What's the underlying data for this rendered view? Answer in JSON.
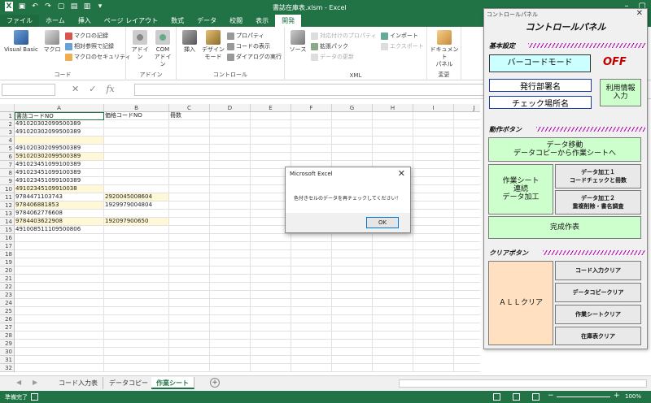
{
  "window": {
    "title": "書誌在庫表.xlsm - Excel"
  },
  "ribbon_tabs": [
    "ファイル",
    "ホーム",
    "挿入",
    "ページ レイアウト",
    "数式",
    "データ",
    "校閲",
    "表示",
    "開発"
  ],
  "ribbon": {
    "code_group": {
      "label": "コード",
      "visual_basic": "Visual Basic",
      "macro": "マクロ",
      "record_macro": "マクロの記録",
      "relative_ref": "相対参照で記録",
      "macro_security": "マクロのセキュリティ"
    },
    "addin_group": {
      "label": "アドイン",
      "addin": "アドイン",
      "com_addin_1": "COM",
      "com_addin_2": "アドイン"
    },
    "controls_group": {
      "label": "コントロール",
      "insert": "挿入",
      "design_mode_1": "デザイン",
      "design_mode_2": "モード",
      "properties": "プロパティ",
      "view_code": "コードの表示",
      "run_dialog": "ダイアログの実行"
    },
    "xml_group": {
      "label": "XML",
      "source": "ソース",
      "map_props": "対応付けのプロパティ",
      "expansion_pack": "拡張パック",
      "refresh": "データの更新",
      "import": "インポート",
      "export": "エクスポート"
    },
    "modify_group": {
      "label": "変更",
      "doc_panel_1": "ドキュメント",
      "doc_panel_2": "パネル"
    }
  },
  "formula_bar": {
    "fx": "fx",
    "cancel": "✕",
    "enter": "✓"
  },
  "columns": [
    "A",
    "B",
    "C",
    "D",
    "E",
    "F",
    "G",
    "H",
    "I",
    "J"
  ],
  "rows": [
    {
      "n": "1",
      "a": "書誌コードNO",
      "b": "価格コードNO",
      "c": "冊数",
      "ya": false,
      "yb": false
    },
    {
      "n": "2",
      "a": "4910203020995003​89",
      "b": "",
      "c": "",
      "ya": false,
      "yb": false
    },
    {
      "n": "3",
      "a": "491020302099500389",
      "b": "",
      "c": "",
      "ya": false,
      "yb": false
    },
    {
      "n": "4",
      "a": "",
      "b": "",
      "c": "",
      "ya": true,
      "yb": false
    },
    {
      "n": "5",
      "a": "491020302099500389",
      "b": "",
      "c": "",
      "ya": false,
      "yb": false
    },
    {
      "n": "6",
      "a": "591020302099500389",
      "b": "",
      "c": "",
      "ya": true,
      "yb": false
    },
    {
      "n": "7",
      "a": "491023451099100389",
      "b": "",
      "c": "",
      "ya": false,
      "yb": false
    },
    {
      "n": "8",
      "a": "491023451099100389",
      "b": "",
      "c": "",
      "ya": false,
      "yb": false
    },
    {
      "n": "9",
      "a": "491023451099100389",
      "b": "",
      "c": "",
      "ya": false,
      "yb": false
    },
    {
      "n": "10",
      "a": "4910234510991003​8",
      "b": "",
      "c": "",
      "ya": true,
      "yb": false
    },
    {
      "n": "11",
      "a": "9784471103743",
      "b": "2920045008604",
      "c": "",
      "ya": false,
      "yb": true
    },
    {
      "n": "12",
      "a": "9784068818​53",
      "b": "1929979004804",
      "c": "",
      "ya": true,
      "yb": false
    },
    {
      "n": "13",
      "a": "9784062776608",
      "b": "",
      "c": "",
      "ya": false,
      "yb": false
    },
    {
      "n": "14",
      "a": "9784403622908",
      "b": "192097900650",
      "c": "",
      "ya": true,
      "yb": true
    },
    {
      "n": "15",
      "a": "491008511109500806",
      "b": "",
      "c": "",
      "ya": false,
      "yb": false
    },
    {
      "n": "16",
      "a": "",
      "b": "",
      "c": "",
      "ya": false,
      "yb": false
    },
    {
      "n": "17",
      "a": "",
      "b": "",
      "c": "",
      "ya": false,
      "yb": false
    },
    {
      "n": "18",
      "a": "",
      "b": "",
      "c": "",
      "ya": false,
      "yb": false
    },
    {
      "n": "19",
      "a": "",
      "b": "",
      "c": "",
      "ya": false,
      "yb": false
    },
    {
      "n": "20",
      "a": "",
      "b": "",
      "c": "",
      "ya": false,
      "yb": false
    },
    {
      "n": "21",
      "a": "",
      "b": "",
      "c": "",
      "ya": false,
      "yb": false
    },
    {
      "n": "22",
      "a": "",
      "b": "",
      "c": "",
      "ya": false,
      "yb": false
    },
    {
      "n": "23",
      "a": "",
      "b": "",
      "c": "",
      "ya": false,
      "yb": false
    },
    {
      "n": "24",
      "a": "",
      "b": "",
      "c": "",
      "ya": false,
      "yb": false
    },
    {
      "n": "25",
      "a": "",
      "b": "",
      "c": "",
      "ya": false,
      "yb": false
    },
    {
      "n": "26",
      "a": "",
      "b": "",
      "c": "",
      "ya": false,
      "yb": false
    },
    {
      "n": "27",
      "a": "",
      "b": "",
      "c": "",
      "ya": false,
      "yb": false
    },
    {
      "n": "28",
      "a": "",
      "b": "",
      "c": "",
      "ya": false,
      "yb": false
    },
    {
      "n": "29",
      "a": "",
      "b": "",
      "c": "",
      "ya": false,
      "yb": false
    },
    {
      "n": "30",
      "a": "",
      "b": "",
      "c": "",
      "ya": false,
      "yb": false
    },
    {
      "n": "31",
      "a": "",
      "b": "",
      "c": "",
      "ya": false,
      "yb": false
    },
    {
      "n": "32",
      "a": "",
      "b": "",
      "c": "",
      "ya": false,
      "yb": false
    }
  ],
  "dialog": {
    "title": "Microsoft Excel",
    "message": "色付きセルのデータを再チェックしてください！",
    "ok": "OK",
    "close": "✕"
  },
  "sheet_tabs": [
    "コード入力表",
    "データコピー",
    "作業シート"
  ],
  "active_sheet": 2,
  "status": {
    "ready": "準備完了",
    "zoom": "100%"
  },
  "panel": {
    "title": "コントロールパネル",
    "close": "✕",
    "heading": "コントロールパネル",
    "basic_settings": "基本設定",
    "barcode_mode": "バーコードモード",
    "off": "OFF",
    "issuer_dept": "発行部署名",
    "check_location": "チェック場所名",
    "user_info_1": "利用情報",
    "user_info_2": "入力",
    "action_buttons": "動作ボタン",
    "data_move_1": "データ移動",
    "data_move_2": "データコピーから作業シートへ",
    "work_sheet_1": "作業シート",
    "work_sheet_2": "連続",
    "work_sheet_3": "データ加工",
    "proc1_1": "データ加工１",
    "proc1_2": "コードチェックと冊数",
    "proc2_1": "データ加工２",
    "proc2_2": "重複削除・書名調査",
    "complete": "完成作表",
    "clear_buttons": "クリアボタン",
    "all_clear": "ＡＬＬクリア",
    "code_input_clear": "コード入力クリア",
    "data_copy_clear": "データコピークリア",
    "work_sheet_clear": "作業シートクリア",
    "inventory_clear": "在庫表クリア"
  },
  "colors": {
    "excel_green": "#217346",
    "highlight_yellow": "#fff8d6",
    "panel_green": "#ccffcc",
    "panel_cyan": "#ccffff",
    "panel_peach": "#ffe0c0",
    "off_red": "#c00000"
  }
}
